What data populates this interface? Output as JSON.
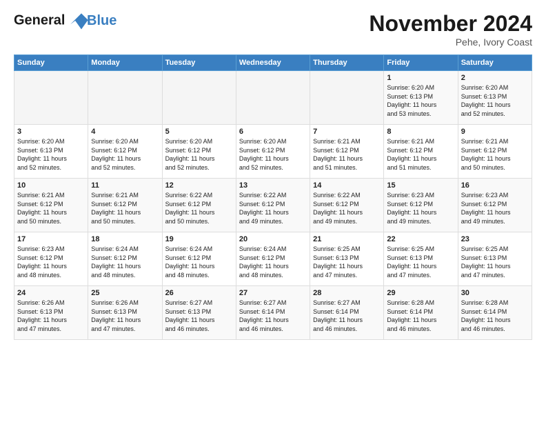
{
  "logo": {
    "line1": "General",
    "line2": "Blue"
  },
  "title": "November 2024",
  "location": "Pehe, Ivory Coast",
  "days_of_week": [
    "Sunday",
    "Monday",
    "Tuesday",
    "Wednesday",
    "Thursday",
    "Friday",
    "Saturday"
  ],
  "weeks": [
    [
      {
        "day": "",
        "info": ""
      },
      {
        "day": "",
        "info": ""
      },
      {
        "day": "",
        "info": ""
      },
      {
        "day": "",
        "info": ""
      },
      {
        "day": "",
        "info": ""
      },
      {
        "day": "1",
        "info": "Sunrise: 6:20 AM\nSunset: 6:13 PM\nDaylight: 11 hours\nand 53 minutes."
      },
      {
        "day": "2",
        "info": "Sunrise: 6:20 AM\nSunset: 6:13 PM\nDaylight: 11 hours\nand 52 minutes."
      }
    ],
    [
      {
        "day": "3",
        "info": "Sunrise: 6:20 AM\nSunset: 6:13 PM\nDaylight: 11 hours\nand 52 minutes."
      },
      {
        "day": "4",
        "info": "Sunrise: 6:20 AM\nSunset: 6:12 PM\nDaylight: 11 hours\nand 52 minutes."
      },
      {
        "day": "5",
        "info": "Sunrise: 6:20 AM\nSunset: 6:12 PM\nDaylight: 11 hours\nand 52 minutes."
      },
      {
        "day": "6",
        "info": "Sunrise: 6:20 AM\nSunset: 6:12 PM\nDaylight: 11 hours\nand 52 minutes."
      },
      {
        "day": "7",
        "info": "Sunrise: 6:21 AM\nSunset: 6:12 PM\nDaylight: 11 hours\nand 51 minutes."
      },
      {
        "day": "8",
        "info": "Sunrise: 6:21 AM\nSunset: 6:12 PM\nDaylight: 11 hours\nand 51 minutes."
      },
      {
        "day": "9",
        "info": "Sunrise: 6:21 AM\nSunset: 6:12 PM\nDaylight: 11 hours\nand 50 minutes."
      }
    ],
    [
      {
        "day": "10",
        "info": "Sunrise: 6:21 AM\nSunset: 6:12 PM\nDaylight: 11 hours\nand 50 minutes."
      },
      {
        "day": "11",
        "info": "Sunrise: 6:21 AM\nSunset: 6:12 PM\nDaylight: 11 hours\nand 50 minutes."
      },
      {
        "day": "12",
        "info": "Sunrise: 6:22 AM\nSunset: 6:12 PM\nDaylight: 11 hours\nand 50 minutes."
      },
      {
        "day": "13",
        "info": "Sunrise: 6:22 AM\nSunset: 6:12 PM\nDaylight: 11 hours\nand 49 minutes."
      },
      {
        "day": "14",
        "info": "Sunrise: 6:22 AM\nSunset: 6:12 PM\nDaylight: 11 hours\nand 49 minutes."
      },
      {
        "day": "15",
        "info": "Sunrise: 6:23 AM\nSunset: 6:12 PM\nDaylight: 11 hours\nand 49 minutes."
      },
      {
        "day": "16",
        "info": "Sunrise: 6:23 AM\nSunset: 6:12 PM\nDaylight: 11 hours\nand 49 minutes."
      }
    ],
    [
      {
        "day": "17",
        "info": "Sunrise: 6:23 AM\nSunset: 6:12 PM\nDaylight: 11 hours\nand 48 minutes."
      },
      {
        "day": "18",
        "info": "Sunrise: 6:24 AM\nSunset: 6:12 PM\nDaylight: 11 hours\nand 48 minutes."
      },
      {
        "day": "19",
        "info": "Sunrise: 6:24 AM\nSunset: 6:12 PM\nDaylight: 11 hours\nand 48 minutes."
      },
      {
        "day": "20",
        "info": "Sunrise: 6:24 AM\nSunset: 6:12 PM\nDaylight: 11 hours\nand 48 minutes."
      },
      {
        "day": "21",
        "info": "Sunrise: 6:25 AM\nSunset: 6:13 PM\nDaylight: 11 hours\nand 47 minutes."
      },
      {
        "day": "22",
        "info": "Sunrise: 6:25 AM\nSunset: 6:13 PM\nDaylight: 11 hours\nand 47 minutes."
      },
      {
        "day": "23",
        "info": "Sunrise: 6:25 AM\nSunset: 6:13 PM\nDaylight: 11 hours\nand 47 minutes."
      }
    ],
    [
      {
        "day": "24",
        "info": "Sunrise: 6:26 AM\nSunset: 6:13 PM\nDaylight: 11 hours\nand 47 minutes."
      },
      {
        "day": "25",
        "info": "Sunrise: 6:26 AM\nSunset: 6:13 PM\nDaylight: 11 hours\nand 47 minutes."
      },
      {
        "day": "26",
        "info": "Sunrise: 6:27 AM\nSunset: 6:13 PM\nDaylight: 11 hours\nand 46 minutes."
      },
      {
        "day": "27",
        "info": "Sunrise: 6:27 AM\nSunset: 6:14 PM\nDaylight: 11 hours\nand 46 minutes."
      },
      {
        "day": "28",
        "info": "Sunrise: 6:27 AM\nSunset: 6:14 PM\nDaylight: 11 hours\nand 46 minutes."
      },
      {
        "day": "29",
        "info": "Sunrise: 6:28 AM\nSunset: 6:14 PM\nDaylight: 11 hours\nand 46 minutes."
      },
      {
        "day": "30",
        "info": "Sunrise: 6:28 AM\nSunset: 6:14 PM\nDaylight: 11 hours\nand 46 minutes."
      }
    ]
  ]
}
